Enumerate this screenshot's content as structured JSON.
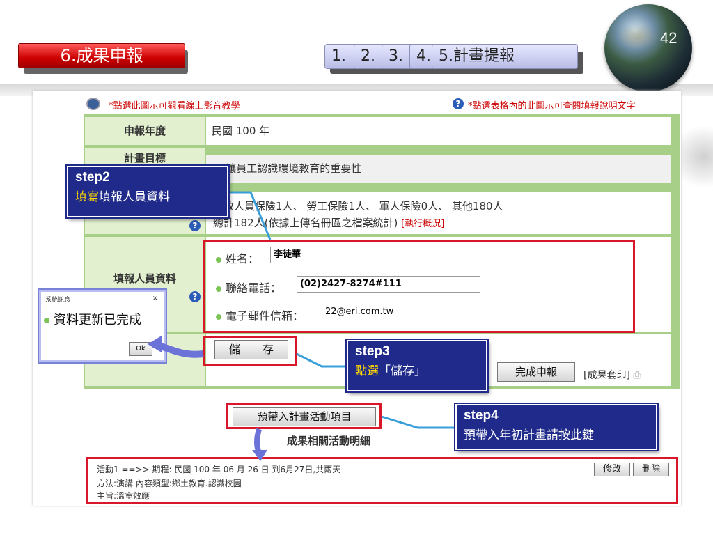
{
  "slide": {
    "page_number": "42",
    "title": "6.成果申報",
    "tabs": [
      "1.",
      "2.",
      "3.",
      "4.",
      "5.計畫提報"
    ]
  },
  "hints": {
    "video_hint": "*點選此圖示可觀看線上影音教學",
    "help_hint": "*點選表格內的此圖示可查閱填報說明文字"
  },
  "form": {
    "year_label": "申報年度",
    "year_value": "民國 100 年",
    "goal_label": "計畫目標",
    "goal_value": "☑ 讓員工認識環境教育的重要性",
    "people_line1": "公教人員保險1人、 勞工保險1人、 軍人保險0人、 其他180人",
    "people_line2": "總計182人(依據上傳名冊區之檔案統計)",
    "people_link": "[執行概況]",
    "reporter_label": "填報人員資料",
    "name_label": "姓名：",
    "name_value": "李徒華",
    "phone_label": "聯絡電話：",
    "phone_value": "(02)2427-8274#111",
    "email_label": "電子郵件信箱：",
    "email_value": "22@eri.com.tw",
    "save_button": "儲　　存",
    "complete_button": "完成申報",
    "print_link": "[成果套印]",
    "import_button": "預帶入計畫活動項目",
    "activity_heading": "成果相關活動明細"
  },
  "activity": {
    "line1": "活動1 ==>> 期程: 民國 100 年 06 月 26 日  到6月27日,共兩天",
    "line2": "方法:演講   內容類型:鄉土教育.認識校園",
    "line3": "主旨:溫室效應",
    "edit_button": "修改",
    "delete_button": "刪除"
  },
  "popup": {
    "title": "系統訊息",
    "close": "×",
    "message": "資料更新已完成",
    "ok": "Ok"
  },
  "steps": {
    "step2_title": "step2",
    "step2_yellow": "填寫",
    "step2_rest": "填報人員資料",
    "step3_title": "step3",
    "step3_yellow": "點選",
    "step3_rest": "「儲存」",
    "step4_title": "step4",
    "step4_text": "預帶入年初計畫請按此鍵"
  },
  "colors": {
    "title_red": "#cc0000",
    "step_blue": "#1f2a8a",
    "highlight_red": "#d8172b",
    "form_green": "#a8cf88"
  }
}
